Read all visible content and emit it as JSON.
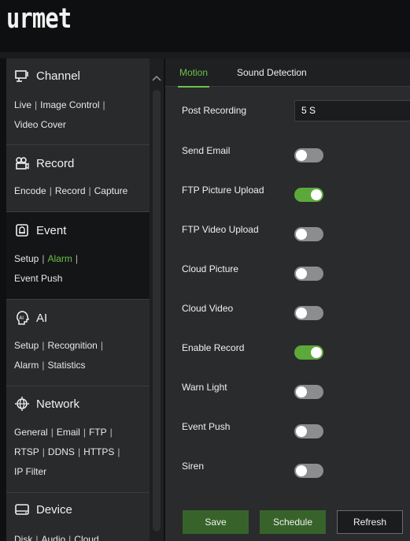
{
  "brand": {
    "logo_text": "urmet"
  },
  "sidebar": {
    "sections": [
      {
        "title": "Channel",
        "icon": "monitor-icon",
        "links": [
          "Live",
          "Image Control",
          "Video Cover"
        ]
      },
      {
        "title": "Record",
        "icon": "camera-recorder-icon",
        "links": [
          "Encode",
          "Record",
          "Capture"
        ]
      },
      {
        "title": "Event",
        "icon": "alarm-bell-icon",
        "links": [
          "Setup",
          "Alarm",
          "Event Push"
        ],
        "active_link": "Alarm"
      },
      {
        "title": "AI",
        "icon": "ai-head-icon",
        "links": [
          "Setup",
          "Recognition",
          "Alarm",
          "Statistics"
        ]
      },
      {
        "title": "Network",
        "icon": "globe-icon",
        "links": [
          "General",
          "Email",
          "FTP",
          "RTSP",
          "DDNS",
          "HTTPS",
          "IP Filter"
        ]
      },
      {
        "title": "Device",
        "icon": "hard-disk-icon",
        "links": [
          "Disk",
          "Audio",
          "Cloud"
        ]
      }
    ],
    "active_section": "Event"
  },
  "tabs": [
    {
      "label": "Motion",
      "active": true
    },
    {
      "label": "Sound Detection",
      "active": false
    }
  ],
  "settings": {
    "post_recording": {
      "label": "Post Recording",
      "value": "5 S"
    },
    "toggles": [
      {
        "label": "Send Email",
        "on": false
      },
      {
        "label": "FTP Picture Upload",
        "on": true
      },
      {
        "label": "FTP Video Upload",
        "on": false
      },
      {
        "label": "Cloud Picture",
        "on": false
      },
      {
        "label": "Cloud Video",
        "on": false
      },
      {
        "label": "Enable Record",
        "on": true
      },
      {
        "label": "Warn Light",
        "on": false
      },
      {
        "label": "Event Push",
        "on": false
      },
      {
        "label": "Siren",
        "on": false
      }
    ]
  },
  "buttons": {
    "save": "Save",
    "schedule": "Schedule",
    "refresh": "Refresh"
  },
  "colors": {
    "accent": "#6cc04a",
    "toggle_on": "#5da83a",
    "toggle_off": "#8c8d8f",
    "button_primary": "#37632b"
  }
}
